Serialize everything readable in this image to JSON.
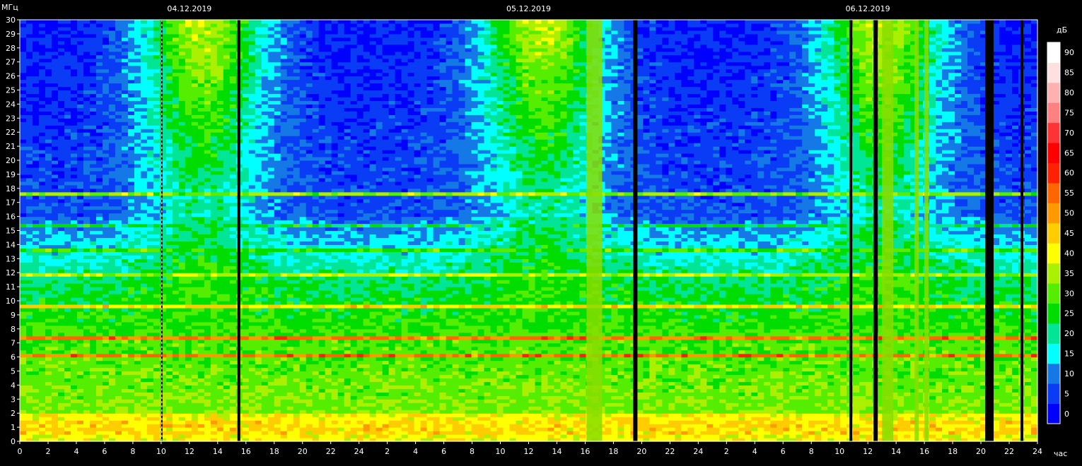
{
  "chart_data": {
    "type": "heatmap",
    "ylabel": "МГц",
    "xlabel": "час",
    "colorbar_label": "дБ",
    "dates": [
      "04.12.2019",
      "05.12.2019",
      "06.12.2019"
    ],
    "y_ticks": [
      0,
      1,
      2,
      3,
      4,
      5,
      6,
      7,
      8,
      9,
      10,
      11,
      12,
      13,
      14,
      15,
      16,
      17,
      18,
      19,
      20,
      21,
      22,
      23,
      24,
      25,
      26,
      27,
      28,
      29,
      30
    ],
    "ylim": [
      0,
      30
    ],
    "x_tick_labels": [
      "0",
      "2",
      "4",
      "6",
      "8",
      "10",
      "12",
      "14",
      "16",
      "18",
      "20",
      "22",
      "24",
      "2",
      "4",
      "6",
      "8",
      "10",
      "12",
      "14",
      "16",
      "18",
      "20",
      "22",
      "24",
      "2",
      "4",
      "6",
      "8",
      "10",
      "12",
      "14",
      "16",
      "18",
      "20",
      "22",
      "24"
    ],
    "colorbar_ticks": [
      0,
      5,
      10,
      15,
      20,
      25,
      30,
      35,
      40,
      45,
      50,
      55,
      60,
      65,
      70,
      75,
      80,
      85,
      90
    ],
    "colorbar_colors": [
      "#0000ff",
      "#0a3cf5",
      "#1478e6",
      "#00ffff",
      "#00e696",
      "#00dd00",
      "#55ee00",
      "#aaf000",
      "#ffff00",
      "#ffcc00",
      "#ff9900",
      "#ff6600",
      "#ff2200",
      "#ff0000",
      "#ff3333",
      "#ff8080",
      "#ffb0b0",
      "#ffe0e0",
      "#ffffff"
    ],
    "day_boundaries_hours": [
      24,
      48
    ],
    "gaps_hours": [
      [
        10.0,
        10.1
      ],
      [
        15.4,
        15.6
      ],
      [
        43.4,
        43.7
      ],
      [
        58.7,
        58.9
      ],
      [
        60.4,
        60.7
      ],
      [
        68.3,
        68.9
      ],
      [
        70.8,
        71.0
      ]
    ],
    "broadband_bursts_hours": [
      [
        40.1,
        41.2
      ],
      [
        61.0,
        61.8
      ],
      [
        63.3,
        63.6
      ],
      [
        64.0,
        64.3
      ]
    ],
    "strong_bands_mhz": [
      [
        0.5,
        1.5,
        45
      ],
      [
        6.0,
        6.2,
        55
      ],
      [
        7.3,
        7.5,
        55
      ],
      [
        9.5,
        9.8,
        45
      ],
      [
        11.7,
        11.9,
        38
      ],
      [
        13.6,
        13.8,
        30
      ],
      [
        15.2,
        15.4,
        25
      ],
      [
        17.6,
        17.8,
        35
      ],
      [
        27.0,
        27.1,
        18
      ],
      [
        29.0,
        29.1,
        15
      ]
    ]
  }
}
